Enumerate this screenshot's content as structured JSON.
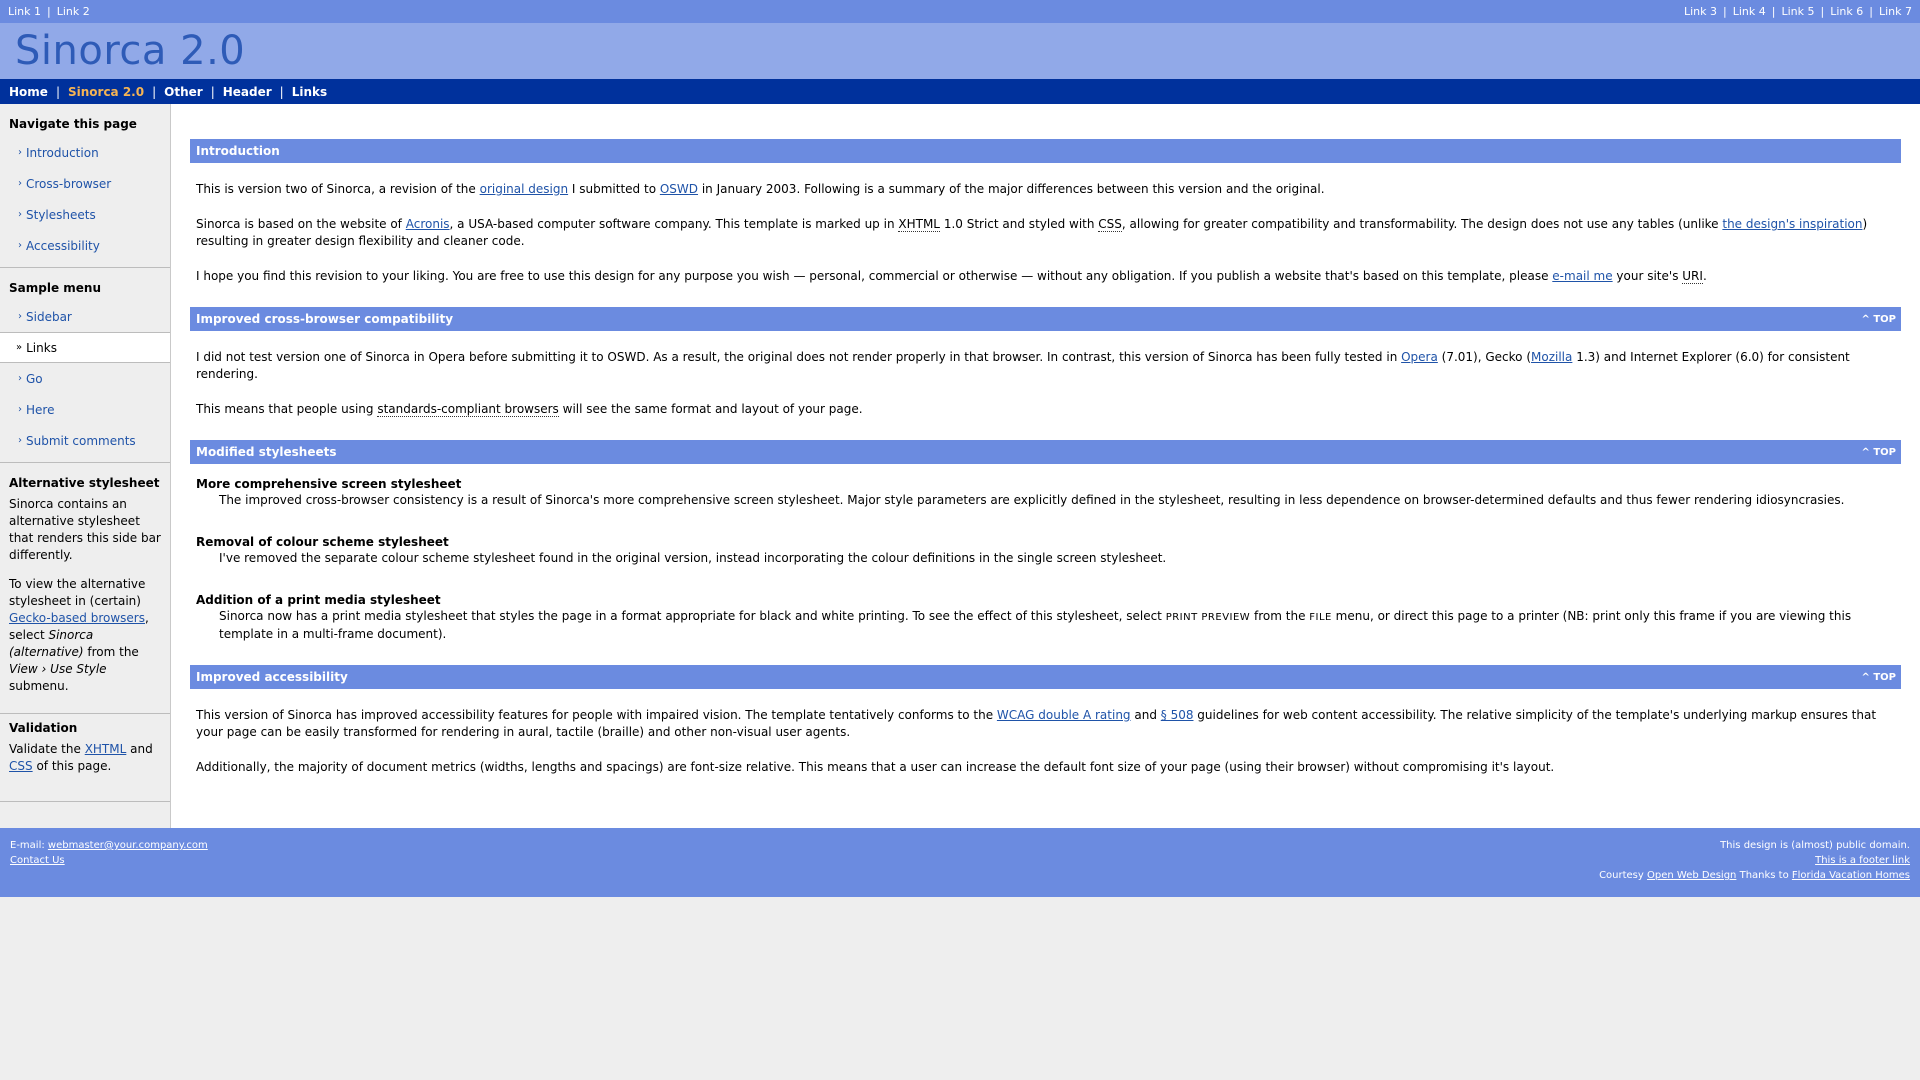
{
  "top_links": {
    "left": [
      "Link 1",
      "Link 2"
    ],
    "right": [
      "Link 3",
      "Link 4",
      "Link 5",
      "Link 6",
      "Link 7"
    ]
  },
  "site_title": "Sinorca 2.0",
  "main_nav": [
    "Home",
    "Sinorca 2.0",
    "Other",
    "Header",
    "Links"
  ],
  "sidebar": {
    "navigate": {
      "title": "Navigate this page",
      "items": [
        "Introduction",
        "Cross-browser",
        "Stylesheets",
        "Accessibility"
      ]
    },
    "sample_menu": {
      "title": "Sample menu",
      "items": [
        "Sidebar",
        "Links",
        "Go",
        "Here",
        "Submit comments"
      ],
      "current": "Links"
    },
    "alt_stylesheet": {
      "title": "Alternative stylesheet",
      "p1": "Sinorca contains an alternative stylesheet that renders this side bar differently.",
      "p2_a": "To view the alternative stylesheet in (certain) ",
      "p2_link": "Gecko-based browsers",
      "p2_b": ", select ",
      "p2_em1": "Sinorca (alternative)",
      "p2_c": " from the ",
      "p2_em2": "View › Use Style",
      "p2_d": " submenu."
    },
    "validation": {
      "title": "Validation",
      "pre": "Validate the ",
      "xhtml": "XHTML",
      "and": " and ",
      "css": "CSS",
      "post": " of this page."
    }
  },
  "sections": {
    "intro": {
      "title": "Introduction",
      "p1_a": "This is version two of Sinorca, a revision of the ",
      "p1_link1": "original design",
      "p1_b": " I submitted to ",
      "p1_link2": "OSWD",
      "p1_c": " in January 2003. Following is a summary of the major differences between this version and the original.",
      "p2_a": "Sinorca is based on the website of ",
      "p2_link1": "Acronis",
      "p2_b": ", a USA-based computer software company. This template is marked up in ",
      "p2_abbr1": "XHTML",
      "p2_c": " 1.0 Strict and styled with ",
      "p2_abbr2": "CSS",
      "p2_d": ", allowing for greater compatibility and transformability. The design does not use any tables (unlike ",
      "p2_link2": "the design's inspiration",
      "p2_e": ") resulting in greater design flexibility and cleaner code.",
      "p3_a": "I hope you find this revision to your liking. You are free to use this design for any purpose you wish — personal, commercial or otherwise — without any obligation. If you publish a website that's based on this template, please ",
      "p3_link": "e-mail me",
      "p3_b": " your site's ",
      "p3_abbr": "URI",
      "p3_c": "."
    },
    "crossbrowser": {
      "title": "Improved cross-browser compatibility",
      "top": "^ TOP",
      "p1_a": "I did not test version one of Sinorca in Opera before submitting it to OSWD. As a result, the original does not render properly in that browser. In contrast, this version of Sinorca has been fully tested in ",
      "p1_link1": "Opera",
      "p1_b": " (7.01), Gecko (",
      "p1_link2": "Mozilla",
      "p1_c": " 1.3) and Internet Explorer (6.0) for consistent rendering.",
      "p2_a": "This means that people using ",
      "p2_abbr": "standards-compliant browsers",
      "p2_b": " will see the same format and layout of your page."
    },
    "stylesheets": {
      "title": "Modified stylesheets",
      "top": "^ TOP",
      "dt1": "More comprehensive screen stylesheet",
      "dd1": "The improved cross-browser consistency is a result of Sinorca's more comprehensive screen stylesheet. Major style parameters are explicitly defined in the stylesheet, resulting in less dependence on browser-determined defaults and thus fewer rendering idiosyncrasies.",
      "dt2": "Removal of colour scheme stylesheet",
      "dd2": "I've removed the separate colour scheme stylesheet found in the original version, instead incorporating the colour definitions in the single screen stylesheet.",
      "dt3": "Addition of a print media stylesheet",
      "dd3_a": "Sinorca now has a print media stylesheet that styles the page in a format appropriate for black and white printing. To see the effect of this stylesheet, select ",
      "dd3_sc1": "PRINT PREVIEW",
      "dd3_b": " from the ",
      "dd3_sc2": "FILE",
      "dd3_c": " menu, or direct this page to a printer (NB: print only this frame if you are viewing this template in a multi-frame document)."
    },
    "accessibility": {
      "title": "Improved accessibility",
      "top": "^ TOP",
      "p1_a": "This version of Sinorca has improved accessibility features for people with impaired vision. The template tentatively conforms to the ",
      "p1_link1": "WCAG double A rating",
      "p1_b": " and ",
      "p1_link2": "§ 508",
      "p1_c": " guidelines for web content accessibility. The relative simplicity of the template's underlying markup ensures that your page can be easily transformed for rendering in aural, tactile (braille) and other non-visual user agents.",
      "p2": "Additionally, the majority of document metrics (widths, lengths and spacings) are font-size relative. This means that a user can increase the default font size of your page (using their browser) without compromising it's layout."
    }
  },
  "footer": {
    "email_label": "E-mail: ",
    "email": "webmaster@your.company.com",
    "contact": "Contact Us",
    "right1": "This design is (almost) public domain.",
    "right2": "This is a footer link",
    "courtesy": "Courtesy ",
    "oswd": "Open Web Design",
    "thanks": " Thanks to ",
    "fvh": "Florida Vacation Homes"
  },
  "colors": {
    "nav_dark": "#00319c",
    "accent_blue": "#6b8be0",
    "title_band": "#91a9e8",
    "active_nav": "#f5b454",
    "link": "#1f53a8"
  }
}
